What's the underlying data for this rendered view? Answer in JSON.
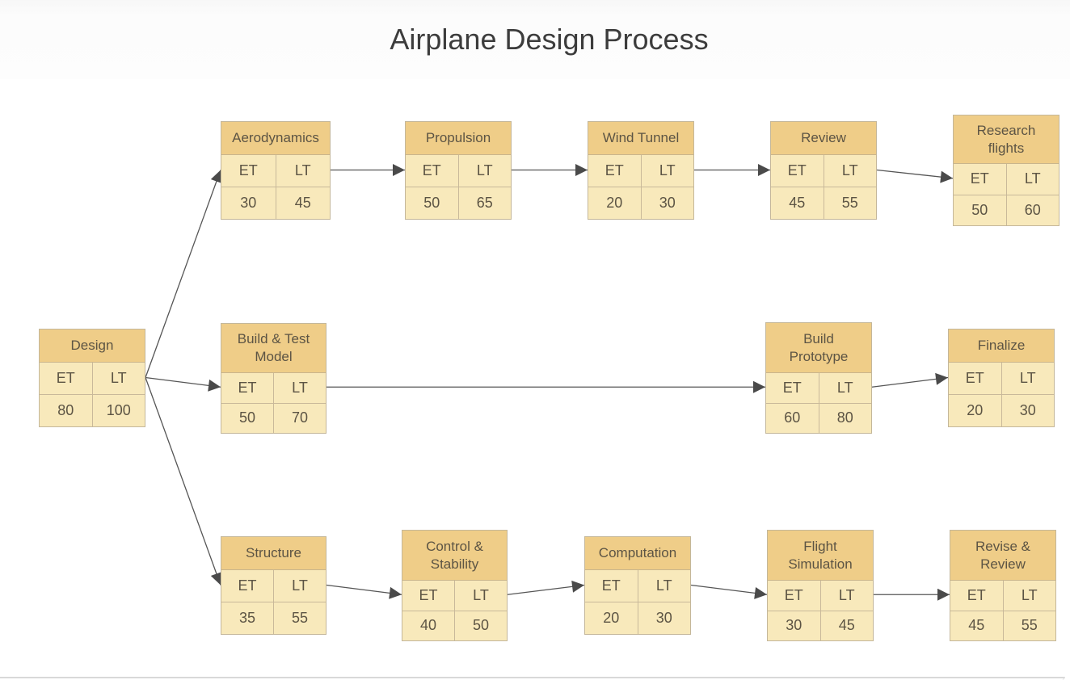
{
  "title": "Airplane Design Process",
  "column_labels": {
    "et": "ET",
    "lt": "LT"
  },
  "nodes": [
    {
      "id": "design",
      "label": "Design",
      "et": "80",
      "lt": "100"
    },
    {
      "id": "aerodynamics",
      "label": "Aerodynamics",
      "et": "30",
      "lt": "45"
    },
    {
      "id": "propulsion",
      "label": "Propulsion",
      "et": "50",
      "lt": "65"
    },
    {
      "id": "wind-tunnel",
      "label": "Wind Tunnel",
      "et": "20",
      "lt": "30"
    },
    {
      "id": "review",
      "label": "Review",
      "et": "45",
      "lt": "55"
    },
    {
      "id": "research-flights",
      "label": "Research\nflights",
      "et": "50",
      "lt": "60"
    },
    {
      "id": "build-test-model",
      "label": "Build & Test\nModel",
      "et": "50",
      "lt": "70"
    },
    {
      "id": "build-prototype",
      "label": "Build\nPrototype",
      "et": "60",
      "lt": "80"
    },
    {
      "id": "finalize",
      "label": "Finalize",
      "et": "20",
      "lt": "30"
    },
    {
      "id": "structure",
      "label": "Structure",
      "et": "35",
      "lt": "55"
    },
    {
      "id": "control-stability",
      "label": "Control &\nStability",
      "et": "40",
      "lt": "50"
    },
    {
      "id": "computation",
      "label": "Computation",
      "et": "20",
      "lt": "30"
    },
    {
      "id": "flight-simulation",
      "label": "Flight\nSimulation",
      "et": "30",
      "lt": "45"
    },
    {
      "id": "revise-review",
      "label": "Revise &\nReview",
      "et": "45",
      "lt": "55"
    }
  ],
  "edges": [
    {
      "from": "design",
      "to": "aerodynamics"
    },
    {
      "from": "design",
      "to": "build-test-model"
    },
    {
      "from": "design",
      "to": "structure"
    },
    {
      "from": "aerodynamics",
      "to": "propulsion"
    },
    {
      "from": "propulsion",
      "to": "wind-tunnel"
    },
    {
      "from": "wind-tunnel",
      "to": "review"
    },
    {
      "from": "review",
      "to": "research-flights"
    },
    {
      "from": "build-test-model",
      "to": "build-prototype"
    },
    {
      "from": "build-prototype",
      "to": "finalize"
    },
    {
      "from": "structure",
      "to": "control-stability"
    },
    {
      "from": "control-stability",
      "to": "computation"
    },
    {
      "from": "computation",
      "to": "flight-simulation"
    },
    {
      "from": "flight-simulation",
      "to": "revise-review"
    }
  ],
  "colors": {
    "header_fill": "#efcd88",
    "body_fill": "#f8e9bb",
    "border": "#c4b79a",
    "edge": "#555555"
  }
}
